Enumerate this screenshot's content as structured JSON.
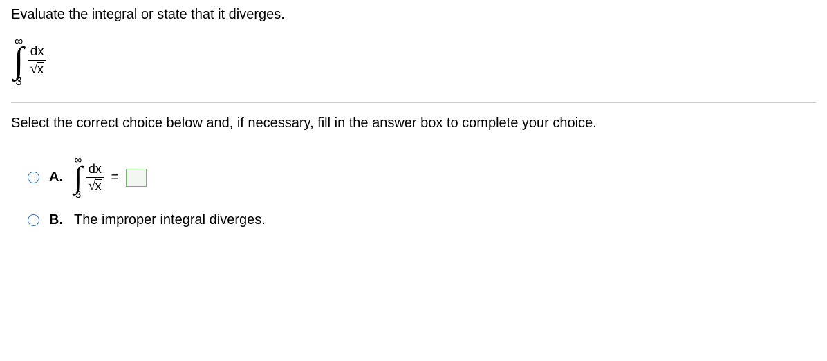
{
  "question": "Evaluate the integral or state that it diverges.",
  "integral": {
    "upper": "∞",
    "lower": "3",
    "numerator": "dx",
    "root_content": "x"
  },
  "instruction": "Select the correct choice below and, if necessary, fill in the answer box to complete your choice.",
  "choices": {
    "a": {
      "label": "A.",
      "integral": {
        "upper": "∞",
        "lower": "3",
        "numerator": "dx",
        "root_content": "x"
      },
      "equals": "="
    },
    "b": {
      "label": "B.",
      "text": "The improper integral diverges."
    }
  }
}
